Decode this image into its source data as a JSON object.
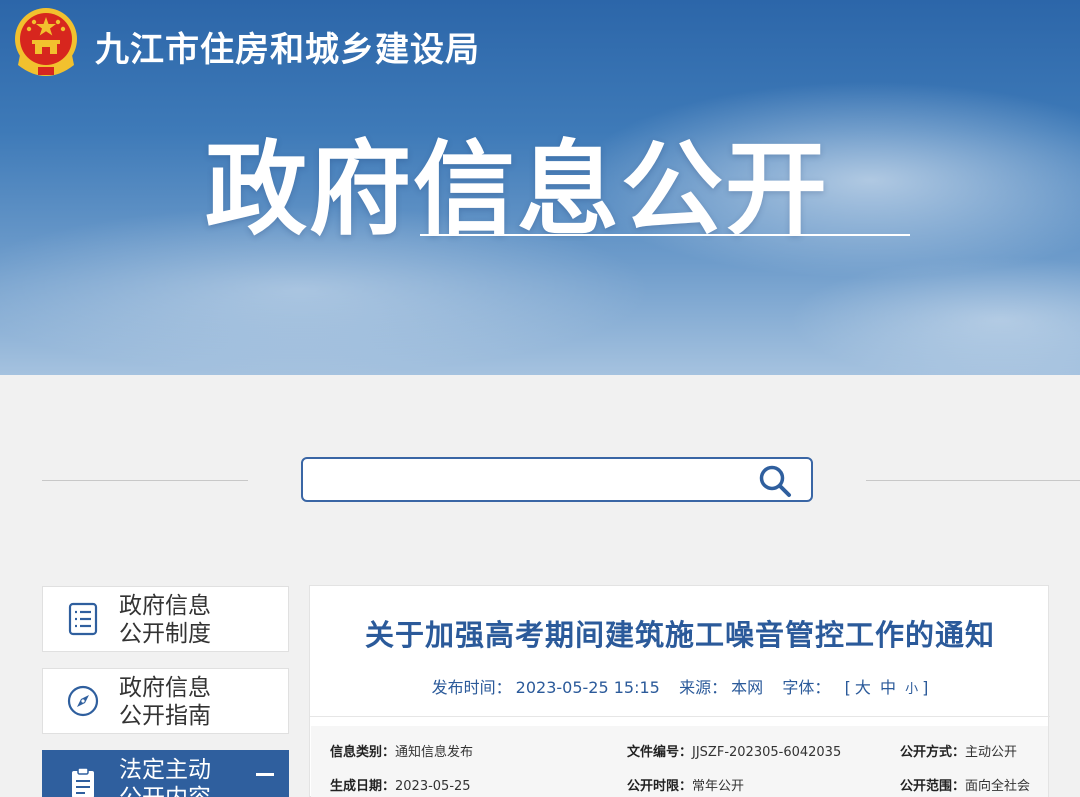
{
  "header": {
    "org_name": "九江市住房和城乡建设局",
    "hero_title": "政府信息公开"
  },
  "search": {
    "placeholder": "",
    "icon": "search-icon"
  },
  "sidebar": {
    "items": [
      {
        "label_line1": "政府信息",
        "label_line2": "公开制度",
        "icon": "list-document-icon"
      },
      {
        "label_line1": "政府信息",
        "label_line2": "公开指南",
        "icon": "compass-icon"
      },
      {
        "label_line1": "法定主动",
        "label_line2": "公开内容",
        "icon": "clipboard-icon"
      }
    ]
  },
  "article": {
    "title": "关于加强高考期间建筑施工噪音管控工作的通知",
    "meta": {
      "publish_label": "发布时间：",
      "publish_time": "2023-05-25 15:15",
      "source_label": "来源：",
      "source": "本网",
      "font_label": "字体：",
      "font_open": "[",
      "font_large": "大",
      "font_medium": "中",
      "font_small": "小",
      "font_close": "]"
    },
    "info": {
      "category_label": "信息类别：",
      "category": "通知信息发布",
      "doc_no_label": "文件编号：",
      "doc_no": "JJSZF-202305-6042035",
      "open_method_label": "公开方式：",
      "open_method": "主动公开",
      "created_label": "生成日期：",
      "created": "2023-05-25",
      "open_period_label": "公开时限：",
      "open_period": "常年公开",
      "open_scope_label": "公开范围：",
      "open_scope": "面向全社会"
    }
  },
  "colors": {
    "brand_blue": "#2f5f9e",
    "title_blue": "#2b5a9a",
    "emblem_red": "#d7261e",
    "emblem_gold": "#f2c12e"
  }
}
